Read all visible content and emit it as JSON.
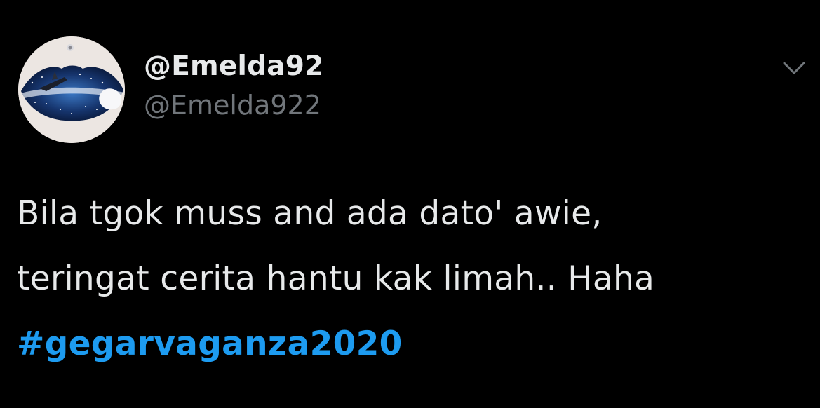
{
  "tweet": {
    "author": {
      "display_name": "@Emelda92",
      "handle": "@Emelda922",
      "avatar_icon": "profile-avatar"
    },
    "menu_icon": "chevron-down-icon",
    "text_lines": [
      "Bila tgok muss and ada dato' awie,",
      "teringat cerita hantu kak limah.. Haha"
    ],
    "hashtag": "#gegarvaganza2020"
  },
  "colors": {
    "background": "#000000",
    "primary_text": "#e7e9ea",
    "secondary_text": "#71767b",
    "link": "#1d9bf0",
    "divider": "#2f3336"
  }
}
